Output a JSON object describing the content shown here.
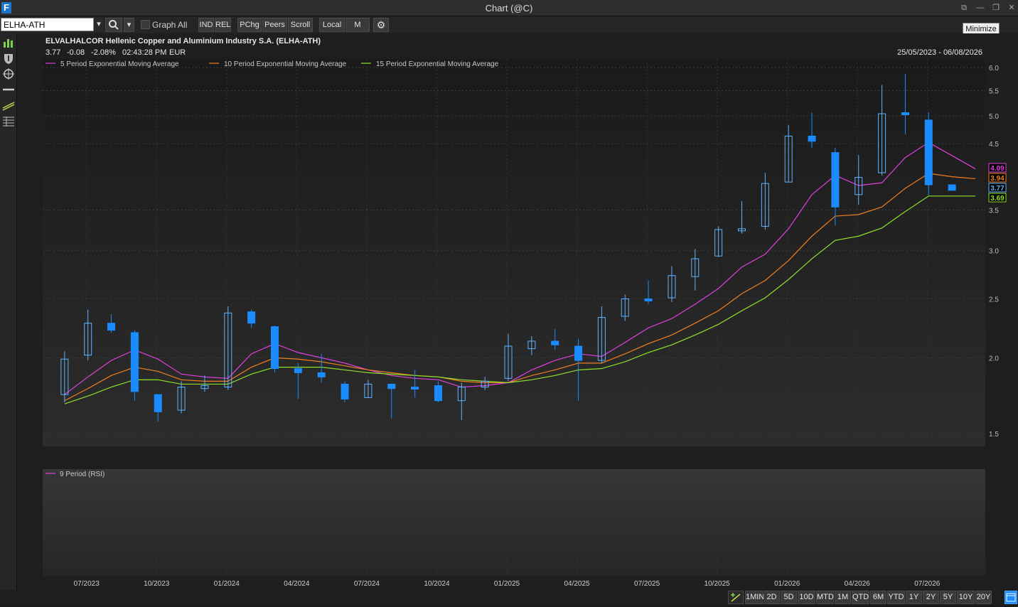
{
  "window": {
    "title": "Chart (@C)",
    "tooltip": "Minimize",
    "logo_text": "F",
    "controls": [
      "restore-to-tab",
      "minimize",
      "maximize",
      "close"
    ]
  },
  "toolbar": {
    "symbol_value": "ELHA-ATH",
    "graph_all_label": "Graph All",
    "graph_all_checked": false,
    "ind_label": "IND",
    "rel_label": "REL",
    "pchg_label": "PChg",
    "peers_label": "Peers",
    "scroll_label": "Scroll",
    "local_label": "Local",
    "m_label": "M"
  },
  "sidebar": {
    "tools": [
      "bar-chart-icon",
      "shield-icon",
      "crosshair-icon",
      "horizontal-line-icon",
      "trend-line-icon",
      "grid-lines-icon"
    ]
  },
  "chart": {
    "header_title": "ELVALHALCOR Hellenic Copper and Aluminium Industry S.A. (ELHA-ATH)",
    "last_price": "3.77",
    "change": "-0.08",
    "change_pct": "-2.08%",
    "time": "02:43:28 PM",
    "currency": "EUR",
    "date_range": "25/05/2023 - 06/08/2026",
    "rsi_label": "9 Period (RSI)",
    "colors": {
      "up_candle": "#5fb3ff",
      "down_candle": "#1a8cff",
      "ema5": "#e040e0",
      "ema10": "#f07f20",
      "ema15": "#8ee02a"
    }
  },
  "chart_data": {
    "type": "candlestick",
    "title": "ELVALHALCOR Hellenic Copper and Aluminium Industry S.A. (ELHA-ATH)",
    "scale": "log",
    "ylim": [
      1.43,
      6.2
    ],
    "yticks": [
      "6.0",
      "5.5",
      "5.0",
      "4.5",
      "3.5",
      "3.0",
      "2.5",
      "2.0",
      "1.5"
    ],
    "xticks": [
      "07/2023",
      "10/2023",
      "01/2024",
      "04/2024",
      "07/2024",
      "10/2024",
      "01/2025",
      "04/2025",
      "07/2025",
      "10/2025",
      "01/2026",
      "04/2026",
      "07/2026"
    ],
    "x_start": "2023-05",
    "x_end": "2026-08",
    "candles": [
      {
        "month": "2023-06",
        "o": 1.74,
        "h": 2.05,
        "l": 1.69,
        "c": 1.99
      },
      {
        "month": "2023-07",
        "o": 2.02,
        "h": 2.4,
        "l": 1.98,
        "c": 2.28
      },
      {
        "month": "2023-08",
        "o": 2.28,
        "h": 2.36,
        "l": 2.2,
        "c": 2.22
      },
      {
        "month": "2023-09",
        "o": 2.2,
        "h": 2.22,
        "l": 1.7,
        "c": 1.76
      },
      {
        "month": "2023-10",
        "o": 1.74,
        "h": 1.74,
        "l": 1.57,
        "c": 1.63
      },
      {
        "month": "2023-11",
        "o": 1.64,
        "h": 1.83,
        "l": 1.62,
        "c": 1.79
      },
      {
        "month": "2023-12",
        "o": 1.78,
        "h": 1.87,
        "l": 1.76,
        "c": 1.8
      },
      {
        "month": "2024-01",
        "o": 1.79,
        "h": 2.43,
        "l": 1.77,
        "c": 2.37
      },
      {
        "month": "2024-02",
        "o": 2.38,
        "h": 2.4,
        "l": 2.24,
        "c": 2.28
      },
      {
        "month": "2024-03",
        "o": 2.25,
        "h": 2.26,
        "l": 1.89,
        "c": 1.92
      },
      {
        "month": "2024-04",
        "o": 1.92,
        "h": 1.96,
        "l": 1.71,
        "c": 1.89
      },
      {
        "month": "2024-05",
        "o": 1.89,
        "h": 2.03,
        "l": 1.82,
        "c": 1.86
      },
      {
        "month": "2024-06",
        "o": 1.81,
        "h": 1.83,
        "l": 1.69,
        "c": 1.71
      },
      {
        "month": "2024-07",
        "o": 1.72,
        "h": 1.84,
        "l": 1.72,
        "c": 1.81
      },
      {
        "month": "2024-08",
        "o": 1.81,
        "h": 1.81,
        "l": 1.59,
        "c": 1.78
      },
      {
        "month": "2024-09",
        "o": 1.79,
        "h": 1.91,
        "l": 1.72,
        "c": 1.78
      },
      {
        "month": "2024-10",
        "o": 1.8,
        "h": 1.83,
        "l": 1.69,
        "c": 1.7
      },
      {
        "month": "2024-11",
        "o": 1.7,
        "h": 1.82,
        "l": 1.58,
        "c": 1.79
      },
      {
        "month": "2024-12",
        "o": 1.79,
        "h": 1.86,
        "l": 1.77,
        "c": 1.83
      },
      {
        "month": "2025-01",
        "o": 1.85,
        "h": 2.19,
        "l": 1.83,
        "c": 2.09
      },
      {
        "month": "2025-02",
        "o": 2.07,
        "h": 2.17,
        "l": 2.02,
        "c": 2.13
      },
      {
        "month": "2025-03",
        "o": 2.13,
        "h": 2.23,
        "l": 2.06,
        "c": 2.1
      },
      {
        "month": "2025-04",
        "o": 2.09,
        "h": 2.15,
        "l": 1.7,
        "c": 1.98
      },
      {
        "month": "2025-05",
        "o": 1.98,
        "h": 2.43,
        "l": 1.96,
        "c": 2.33
      },
      {
        "month": "2025-06",
        "o": 2.34,
        "h": 2.54,
        "l": 2.3,
        "c": 2.5
      },
      {
        "month": "2025-07",
        "o": 2.5,
        "h": 2.68,
        "l": 2.45,
        "c": 2.48
      },
      {
        "month": "2025-08",
        "o": 2.51,
        "h": 2.83,
        "l": 2.47,
        "c": 2.73
      },
      {
        "month": "2025-09",
        "o": 2.72,
        "h": 3.02,
        "l": 2.58,
        "c": 2.91
      },
      {
        "month": "2025-10",
        "o": 2.94,
        "h": 3.29,
        "l": 2.93,
        "c": 3.25
      },
      {
        "month": "2025-11",
        "o": 3.26,
        "h": 3.62,
        "l": 3.2,
        "c": 3.26
      },
      {
        "month": "2025-12",
        "o": 3.29,
        "h": 4.03,
        "l": 3.25,
        "c": 3.87
      },
      {
        "month": "2026-01",
        "o": 3.89,
        "h": 4.83,
        "l": 3.89,
        "c": 4.63
      },
      {
        "month": "2026-02",
        "o": 4.63,
        "h": 5.06,
        "l": 4.43,
        "c": 4.54
      },
      {
        "month": "2026-03",
        "o": 4.35,
        "h": 4.43,
        "l": 3.3,
        "c": 3.54
      },
      {
        "month": "2026-04",
        "o": 3.71,
        "h": 4.31,
        "l": 3.57,
        "c": 3.96
      },
      {
        "month": "2026-05",
        "o": 4.03,
        "h": 5.62,
        "l": 3.99,
        "c": 5.04
      },
      {
        "month": "2026-06",
        "o": 5.06,
        "h": 5.86,
        "l": 4.66,
        "c": 5.02
      },
      {
        "month": "2026-07",
        "o": 4.92,
        "h": 5.07,
        "l": 3.7,
        "c": 3.85
      },
      {
        "month": "2026-08",
        "o": 3.85,
        "h": 3.85,
        "l": 3.77,
        "c": 3.77
      }
    ],
    "series": [
      {
        "name": "5 Period Exponential Moving Average",
        "color": "#e040e0",
        "values": [
          1.74,
          1.86,
          1.98,
          2.06,
          1.99,
          1.88,
          1.86,
          1.85,
          2.03,
          2.11,
          2.04,
          2.0,
          1.96,
          1.91,
          1.87,
          1.85,
          1.84,
          1.79,
          1.8,
          1.82,
          1.91,
          1.98,
          2.03,
          2.01,
          2.12,
          2.24,
          2.32,
          2.45,
          2.6,
          2.82,
          2.96,
          3.26,
          3.71,
          3.99,
          3.84,
          3.88,
          4.27,
          4.52,
          4.3,
          4.09
        ],
        "last_label": "4.09"
      },
      {
        "name": "10 Period Exponential Moving Average",
        "color": "#f07f20",
        "values": [
          1.7,
          1.78,
          1.87,
          1.93,
          1.9,
          1.84,
          1.83,
          1.83,
          1.93,
          2.0,
          1.99,
          1.97,
          1.94,
          1.91,
          1.89,
          1.87,
          1.86,
          1.83,
          1.82,
          1.82,
          1.87,
          1.91,
          1.96,
          1.96,
          2.03,
          2.11,
          2.18,
          2.28,
          2.39,
          2.55,
          2.68,
          2.89,
          3.17,
          3.42,
          3.44,
          3.54,
          3.8,
          4.02,
          3.97,
          3.94
        ],
        "last_label": "3.94"
      },
      {
        "name": "15 Period Exponential Moving Average",
        "color": "#8ee02a",
        "values": [
          1.68,
          1.73,
          1.79,
          1.84,
          1.84,
          1.81,
          1.81,
          1.81,
          1.88,
          1.93,
          1.93,
          1.93,
          1.91,
          1.89,
          1.88,
          1.87,
          1.86,
          1.84,
          1.83,
          1.82,
          1.84,
          1.87,
          1.91,
          1.92,
          1.97,
          2.04,
          2.1,
          2.18,
          2.27,
          2.39,
          2.51,
          2.69,
          2.91,
          3.12,
          3.17,
          3.27,
          3.48,
          3.69,
          3.69,
          3.69
        ],
        "last_label": "3.69"
      }
    ],
    "last_price_label": "3.77"
  },
  "timeframes": [
    "1MIN",
    "2D",
    "5D",
    "10D",
    "MTD",
    "1M",
    "QTD",
    "6M",
    "YTD",
    "1Y",
    "2Y",
    "5Y",
    "10Y",
    "20Y"
  ]
}
